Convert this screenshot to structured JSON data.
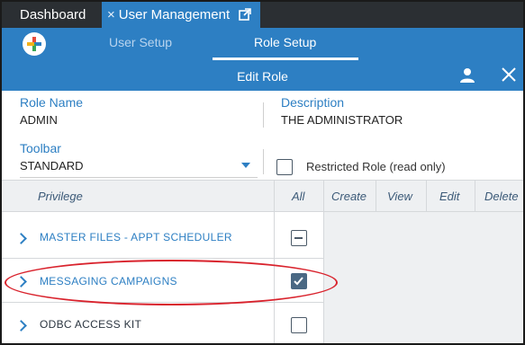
{
  "tabs": {
    "dashboard": "Dashboard",
    "active_close": "×",
    "active_label": "User Management"
  },
  "nav": {
    "user_setup": "User Setup",
    "role_setup": "Role Setup"
  },
  "subbar": {
    "title": "Edit Role"
  },
  "form": {
    "role_name_label": "Role Name",
    "role_name_value": "ADMIN",
    "description_label": "Description",
    "description_value": "THE ADMINISTRATOR",
    "toolbar_label": "Toolbar",
    "toolbar_value": "STANDARD",
    "restricted_label": "Restricted Role (read only)",
    "restricted_checked": false
  },
  "grid": {
    "headers": [
      "Privilege",
      "All",
      "Create",
      "View",
      "Edit",
      "Delete"
    ],
    "rows": [
      {
        "label": "MASTER FILES - APPT SCHEDULER",
        "all_state": "partial"
      },
      {
        "label": "MESSAGING CAMPAIGNS",
        "all_state": "checked"
      },
      {
        "label": "ODBC ACCESS KIT",
        "all_state": "unchecked"
      }
    ]
  },
  "colors": {
    "accent": "#2d7fc3",
    "tabstrip": "#2b2f33",
    "highlight": "#d9232d",
    "checked_fill": "#4a6883"
  },
  "icons": [
    "plus-logo-icon",
    "external-link-icon",
    "user-icon",
    "close-icon",
    "chevron-right-icon",
    "dropdown-caret-icon"
  ]
}
